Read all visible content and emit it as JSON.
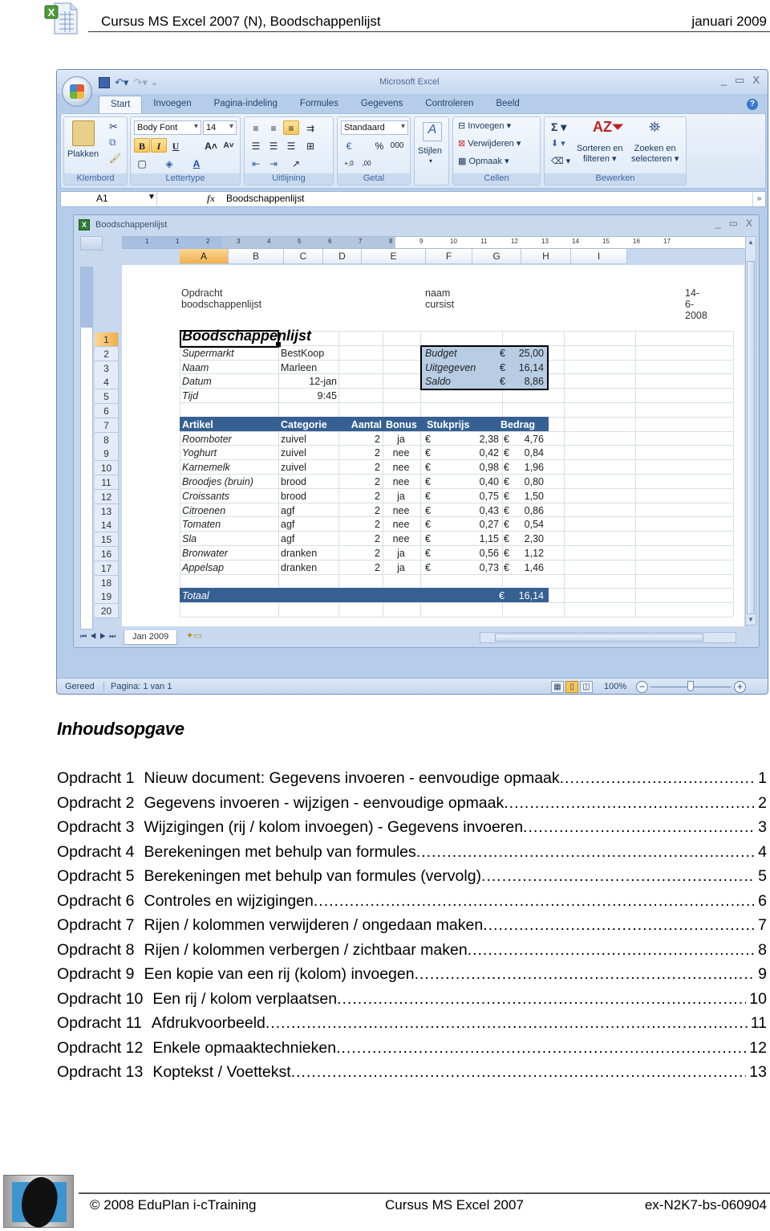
{
  "doc_header": {
    "icon": "excel-document-icon",
    "title": "Cursus MS Excel 2007 (N), Boodschappenlijst",
    "date": "januari 2009"
  },
  "excel": {
    "app_title": "Microsoft Excel",
    "quick_access": [
      "save-icon",
      "undo-icon",
      "redo-icon",
      "customize-icon"
    ],
    "window_controls": [
      "_",
      "▭",
      "X"
    ],
    "tabs": [
      "Start",
      "Invoegen",
      "Pagina-indeling",
      "Formules",
      "Gegevens",
      "Controleren",
      "Beeld"
    ],
    "active_tab": "Start",
    "ribbon": {
      "klembord": {
        "label": "Klembord",
        "paste": "Plakken"
      },
      "lettertype": {
        "label": "Lettertype",
        "font": "Body Font",
        "size": "14",
        "bold": "B",
        "italic": "I",
        "underline": "U"
      },
      "uitlijning": {
        "label": "Uitlijning"
      },
      "getal": {
        "label": "Getal",
        "format": "Standaard",
        "percent": "%",
        "thousands": "000",
        "inc_dec": "⁺,0 ,00",
        "dec_dec": ",00 ⁺,0"
      },
      "stijlen": {
        "label": "Stijlen"
      },
      "cellen": {
        "label": "Cellen",
        "insert": "Invoegen",
        "delete": "Verwijderen",
        "format": "Opmaak"
      },
      "bewerken": {
        "label": "Bewerken",
        "sort_line1": "Sorteren en",
        "sort_line2": "filteren",
        "find_line1": "Zoeken en",
        "find_line2": "selecteren"
      }
    },
    "formula_bar": {
      "name_box": "A1",
      "fx": "fx",
      "value": "Boodschappenlijst"
    },
    "workbook": {
      "title": "Boodschappenlijst",
      "columns": [
        "A",
        "B",
        "C",
        "D",
        "E",
        "F",
        "G",
        "H",
        "I"
      ],
      "selected_column": "A",
      "rows": [
        "1",
        "2",
        "3",
        "4",
        "5",
        "6",
        "7",
        "8",
        "9",
        "10",
        "11",
        "12",
        "13",
        "14",
        "15",
        "16",
        "17",
        "18",
        "19",
        "20"
      ],
      "selected_row": "1",
      "ruler_numbers": [
        "1",
        "1",
        "2",
        "3",
        "4",
        "5",
        "6",
        "7",
        "8",
        "9",
        "10",
        "11",
        "12",
        "13",
        "14",
        "15",
        "16",
        "17"
      ],
      "page_header": {
        "left": "Opdracht boodschappenlijst",
        "center": "naam cursist",
        "right": "14-6-2008"
      },
      "info": [
        {
          "label": "Supermarkt",
          "value": "BestKoop"
        },
        {
          "label": "Naam",
          "value": "Marleen"
        },
        {
          "label": "Datum",
          "value": "12-jan"
        },
        {
          "label": "Tijd",
          "value": "9:45"
        }
      ],
      "budget": [
        {
          "label": "Budget",
          "currency": "€",
          "value": "25,00"
        },
        {
          "label": "Uitgegeven",
          "currency": "€",
          "value": "16,14"
        },
        {
          "label": "Saldo",
          "currency": "€",
          "value": "8,86"
        }
      ],
      "table_headers": [
        "Artikel",
        "Categorie",
        "Aantal",
        "Bonus",
        "Stukprijs",
        "Bedrag"
      ],
      "table_rows": [
        {
          "artikel": "Roomboter",
          "categorie": "zuivel",
          "aantal": "2",
          "bonus": "ja",
          "stukprijs": "2,38",
          "bedrag": "4,76"
        },
        {
          "artikel": "Yoghurt",
          "categorie": "zuivel",
          "aantal": "2",
          "bonus": "nee",
          "stukprijs": "0,42",
          "bedrag": "0,84"
        },
        {
          "artikel": "Karnemelk",
          "categorie": "zuivel",
          "aantal": "2",
          "bonus": "nee",
          "stukprijs": "0,98",
          "bedrag": "1,96"
        },
        {
          "artikel": "Broodjes (bruin)",
          "categorie": "brood",
          "aantal": "2",
          "bonus": "nee",
          "stukprijs": "0,40",
          "bedrag": "0,80"
        },
        {
          "artikel": "Croissants",
          "categorie": "brood",
          "aantal": "2",
          "bonus": "ja",
          "stukprijs": "0,75",
          "bedrag": "1,50"
        },
        {
          "artikel": "Citroenen",
          "categorie": "agf",
          "aantal": "2",
          "bonus": "nee",
          "stukprijs": "0,43",
          "bedrag": "0,86"
        },
        {
          "artikel": "Tomaten",
          "categorie": "agf",
          "aantal": "2",
          "bonus": "nee",
          "stukprijs": "0,27",
          "bedrag": "0,54"
        },
        {
          "artikel": "Sla",
          "categorie": "agf",
          "aantal": "2",
          "bonus": "nee",
          "stukprijs": "1,15",
          "bedrag": "2,30"
        },
        {
          "artikel": "Bronwater",
          "categorie": "dranken",
          "aantal": "2",
          "bonus": "ja",
          "stukprijs": "0,56",
          "bedrag": "1,12"
        },
        {
          "artikel": "Appelsap",
          "categorie": "dranken",
          "aantal": "2",
          "bonus": "ja",
          "stukprijs": "0,73",
          "bedrag": "1,46"
        }
      ],
      "currency": "€",
      "total": {
        "label": "Totaal",
        "currency": "€",
        "value": "16,14"
      },
      "sheet_tab": "Jan 2009",
      "sheet_nav": "⏮◀▶⏭"
    },
    "status_bar": {
      "ready": "Gereed",
      "page": "Pagina: 1 van 1",
      "zoom": "100%",
      "zoom_fraction": 0.5
    }
  },
  "toc": {
    "title": "Inhoudsopgave",
    "entries": [
      {
        "num": "Opdracht 1",
        "title": "Nieuw document: Gegevens invoeren - eenvoudige opmaak",
        "page": "1"
      },
      {
        "num": "Opdracht 2",
        "title": "Gegevens invoeren - wijzigen - eenvoudige opmaak",
        "page": "2"
      },
      {
        "num": "Opdracht 3",
        "title": "Wijzigingen (rij / kolom invoegen) - Gegevens invoeren",
        "page": "3"
      },
      {
        "num": "Opdracht 4",
        "title": "Berekeningen met behulp van formules",
        "page": "4"
      },
      {
        "num": "Opdracht 5",
        "title": "Berekeningen met behulp van formules (vervolg)",
        "page": "5"
      },
      {
        "num": "Opdracht 6",
        "title": "Controles en wijzigingen",
        "page": "6"
      },
      {
        "num": "Opdracht 7",
        "title": "Rijen / kolommen  verwijderen / ongedaan maken",
        "page": "7"
      },
      {
        "num": "Opdracht 8",
        "title": "Rijen / kolommen  verbergen / zichtbaar maken",
        "page": "8"
      },
      {
        "num": "Opdracht  9",
        "title": "Een kopie van een rij (kolom) invoegen",
        "page": "9"
      },
      {
        "num": "Opdracht 10",
        "title": "Een rij / kolom verplaatsen",
        "page": "10"
      },
      {
        "num": "Opdracht 11",
        "title": "Afdrukvoorbeeld",
        "page": "11"
      },
      {
        "num": "Opdracht 12",
        "title": "Enkele opmaaktechnieken",
        "page": "12"
      },
      {
        "num": "Opdracht 13",
        "title": "Koptekst / Voettekst",
        "page": "13"
      }
    ]
  },
  "footer": {
    "logo": "eduplan-logo",
    "copyright": "© 2008 EduPlan i-cTraining",
    "course": "Cursus MS Excel 2007",
    "code": "ex-N2K7-bs-060904"
  }
}
